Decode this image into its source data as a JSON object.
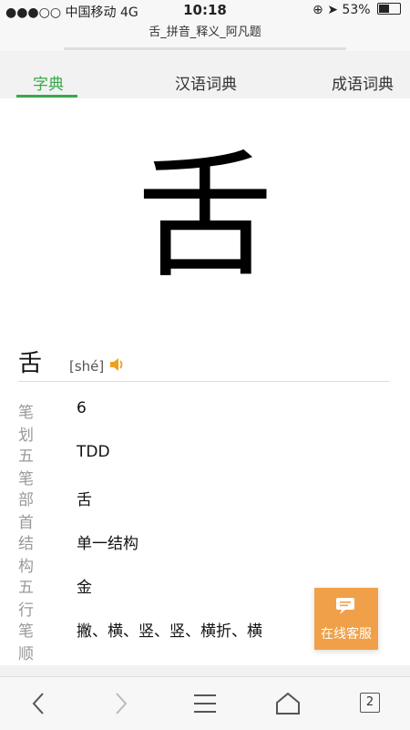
{
  "status_bar": {
    "carrier": "●●●○○ 中国移动",
    "network": "4G",
    "time": "10:18",
    "battery": "53%"
  },
  "browser": {
    "page_title": "舌_拼音_释义_阿凡题"
  },
  "tabs": [
    {
      "label": "字典",
      "active": true
    },
    {
      "label": "汉语词典",
      "active": false
    },
    {
      "label": "成语词典",
      "active": false
    }
  ],
  "character": {
    "glyph": "舌",
    "pinyin": "[shé]"
  },
  "info": [
    {
      "key": "笔划",
      "value": "6"
    },
    {
      "key": "五笔",
      "value": "TDD"
    },
    {
      "key": "部首",
      "value": "舌"
    },
    {
      "key": "结构",
      "value": "单一结构"
    },
    {
      "key": "五行",
      "value": "金"
    },
    {
      "key": "笔顺",
      "value": "撇、横、竖、竖、横折、横"
    }
  ],
  "service": {
    "label": "在线客服"
  },
  "toolbar": {
    "tab_count": "2"
  },
  "colors": {
    "accent": "#3aa84b",
    "service": "#f0a048"
  }
}
